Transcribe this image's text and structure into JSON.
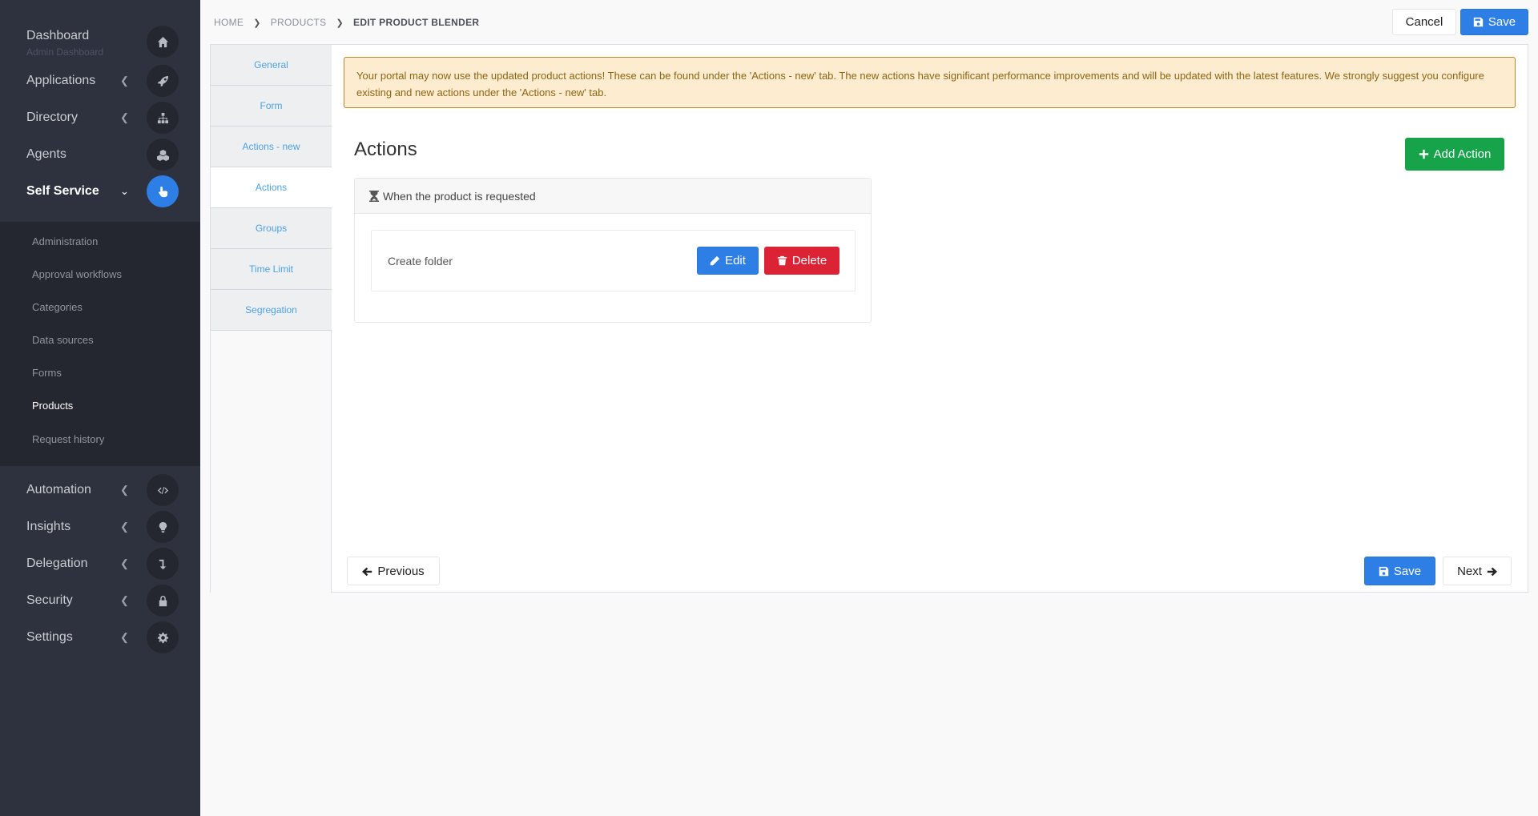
{
  "sidebar": {
    "items": [
      {
        "label": "Dashboard",
        "sub": "Admin Dashboard",
        "icon": "home-icon"
      },
      {
        "label": "Applications",
        "icon": "rocket-icon"
      },
      {
        "label": "Directory",
        "icon": "sitemap-icon"
      },
      {
        "label": "Agents",
        "icon": "cubes-icon"
      },
      {
        "label": "Self Service",
        "icon": "pointer-hand-icon"
      },
      {
        "label": "Automation",
        "icon": "code-icon"
      },
      {
        "label": "Insights",
        "icon": "lightbulb-icon"
      },
      {
        "label": "Delegation",
        "icon": "level-down-icon"
      },
      {
        "label": "Security",
        "icon": "lock-icon"
      },
      {
        "label": "Settings",
        "icon": "gear-icon"
      }
    ],
    "submenu": [
      "Administration",
      "Approval workflows",
      "Categories",
      "Data sources",
      "Forms",
      "Products",
      "Request history"
    ]
  },
  "breadcrumb": {
    "home": "HOME",
    "products": "PRODUCTS",
    "current": "EDIT PRODUCT BLENDER"
  },
  "header": {
    "cancel": "Cancel",
    "save": "Save"
  },
  "tabs": [
    "General",
    "Form",
    "Actions - new",
    "Actions",
    "Groups",
    "Time Limit",
    "Segregation"
  ],
  "alert": "Your portal may now use the updated product actions! These can be found under the 'Actions - new' tab. The new actions have significant performance improvements and will be updated with the latest features. We strongly suggest you configure existing and new actions under the 'Actions - new' tab.",
  "main": {
    "title": "Actions",
    "add_action": "Add Action",
    "trigger": "When the product is requested",
    "action_name": "Create folder",
    "edit": "Edit",
    "delete": "Delete"
  },
  "footer": {
    "previous": "Previous",
    "save": "Save",
    "next": "Next"
  },
  "colors": {
    "sidebar": "#2e323e",
    "primary": "#2d7fe6",
    "success": "#16a34a",
    "danger": "#dc2235",
    "warning_bg": "#fdecd0"
  }
}
